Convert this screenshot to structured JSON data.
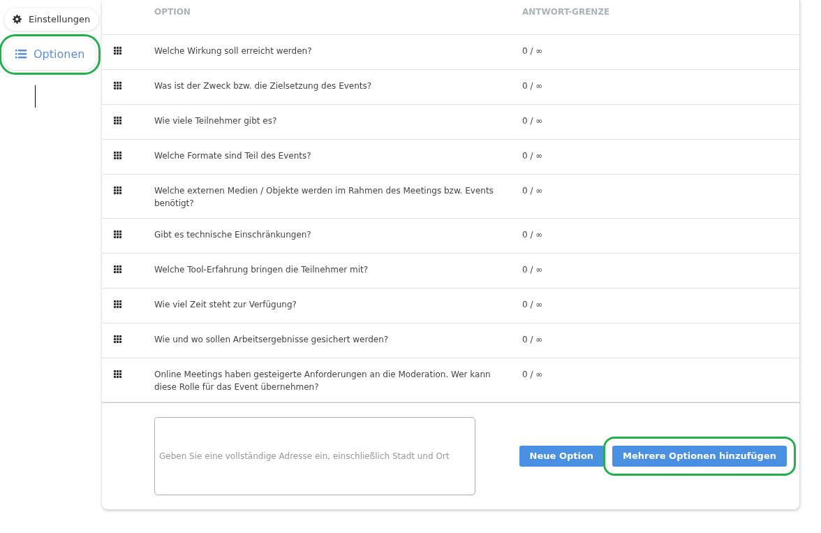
{
  "sidebar": {
    "items": [
      {
        "label": "Einstellungen",
        "selected": false,
        "highlighted": false
      },
      {
        "label": "Optionen",
        "selected": true,
        "highlighted": true
      }
    ]
  },
  "table": {
    "columns": [
      "OPTION",
      "ANTWORT-GRENZE"
    ],
    "rows": [
      {
        "option": "Welche Wirkung soll erreicht werden?",
        "limit": "0 / ∞"
      },
      {
        "option": "Was ist der Zweck bzw. die Zielsetzung des Events?",
        "limit": "0 / ∞"
      },
      {
        "option": "Wie viele Teilnehmer gibt es?",
        "limit": "0 / ∞"
      },
      {
        "option": "Welche Formate sind Teil des Events?",
        "limit": "0 / ∞"
      },
      {
        "option": "Welche externen Medien / Objekte werden im Rahmen des Meetings bzw. Events benötigt?",
        "limit": "0 / ∞"
      },
      {
        "option": "Gibt es technische Einschränkungen?",
        "limit": "0 / ∞"
      },
      {
        "option": "Welche Tool-Erfahrung bringen die Teilnehmer mit?",
        "limit": "0 / ∞"
      },
      {
        "option": "Wie viel Zeit steht zur Verfügung?",
        "limit": "0 / ∞"
      },
      {
        "option": "Wie und wo sollen Arbeitsergebnisse gesichert werden?",
        "limit": "0 / ∞"
      },
      {
        "option": "Online Meetings haben gesteigerte Anforderungen an die Moderation. Wer kann diese Rolle für das Event übernehmen?",
        "limit": "0 / ∞"
      }
    ]
  },
  "new_option": {
    "placeholder": "Geben Sie eine vollständige Adresse ein, einschließlich Stadt und Ort"
  },
  "buttons": [
    {
      "label": "Neue Option",
      "highlighted": false
    },
    {
      "label": "Mehrere Optionen hinzufügen",
      "highlighted": true
    }
  ]
}
